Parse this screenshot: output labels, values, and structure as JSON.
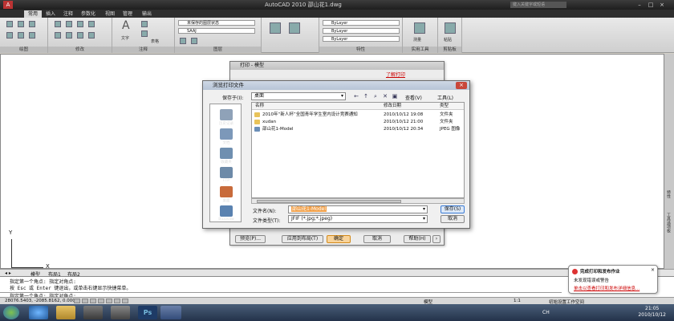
{
  "app": {
    "title": "AutoCAD 2010    邵山花1.dwg",
    "search_placeholder": "键入关键字或短语"
  },
  "ribbon_tabs": [
    "常用",
    "插入",
    "注释",
    "参数化",
    "视图",
    "管理",
    "输出"
  ],
  "ribbon": {
    "panels": [
      "绘图",
      "修改",
      "注释",
      "图层",
      "特性",
      "实用工具",
      "剪贴板"
    ],
    "text_label": "文字",
    "table_label": "表格",
    "layer_state": "未保存的图层状态",
    "layer_name": "SAAJ",
    "bylayer": "ByLayer",
    "bylayer2": "ByLayer",
    "bylayer3": "ByLayer",
    "measure_label": "测量",
    "paste_label": "粘贴"
  },
  "layout_tabs": [
    "模型",
    "布局1",
    "布局2"
  ],
  "axes": {
    "x": "X",
    "y": "Y"
  },
  "command_lines": [
    "指定第一个角点: 指定对角点:",
    "按 Esc 或 Enter 键退出，或单击右键显示快捷菜单。",
    "指定第一个角点: 指定对角点:"
  ],
  "status": {
    "coords": "28076.5403, -2085.8162, 0.0000",
    "model_label": "模型",
    "scale": "1:1",
    "workspace": "初始设置工作空间"
  },
  "taskbar": {
    "lang": "CH",
    "time": "21:05",
    "date": "2010/10/12"
  },
  "right_palette": [
    "特性",
    "工具选项板"
  ],
  "print_dialog": {
    "title": "打印 - 模型",
    "link": "了解打印",
    "buttons": [
      "预览(P)...",
      "应用到布局(T)",
      "确定",
      "取消",
      "帮助(H)"
    ]
  },
  "browse_dialog": {
    "title": "浏览打印文件",
    "save_in_label": "保存于(I):",
    "save_in_value": "桌面",
    "view_label": "查看(V)",
    "tools_label": "工具(L)",
    "places": [
      "历史记录",
      "文档",
      "收藏夹",
      "FTP",
      "桌面",
      "Buzzsaw"
    ],
    "columns": [
      "名称",
      "修改日期",
      "类型"
    ],
    "files": [
      {
        "name": "2010年“新人杯”全国青年学生室内设计竞赛通知",
        "date": "2010/10/12 19:08",
        "type": "文件夹"
      },
      {
        "name": "xudan",
        "date": "2010/10/12 21:00",
        "type": "文件夹"
      },
      {
        "name": "邵山花1-Model",
        "date": "2010/10/12 20:34",
        "type": "JPEG 图像"
      }
    ],
    "filename_label": "文件名(N):",
    "filename_value": "邵山花1-Model",
    "filetype_label": "文件类型(T):",
    "filetype_value": "JFIF (*.jpg;*.jpeg)",
    "save_button": "保存(S)",
    "cancel_button": "取消"
  },
  "notification": {
    "title": "完成打印和发布作业",
    "line1": "未发现错误或警告",
    "link": "单击以查看打印和发布详细信息..."
  }
}
